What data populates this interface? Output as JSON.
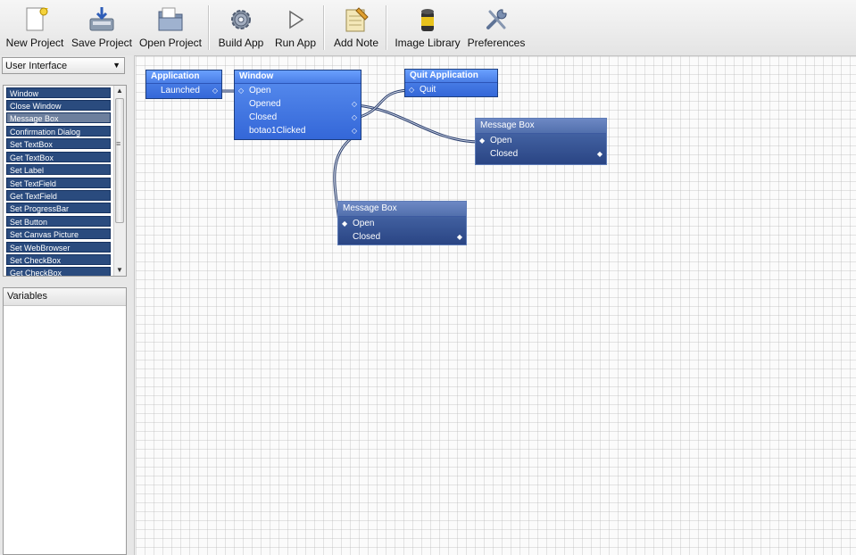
{
  "toolbar": {
    "items": [
      {
        "label": "New Project",
        "icon": "new-project-icon"
      },
      {
        "label": "Save Project",
        "icon": "save-project-icon"
      },
      {
        "label": "Open Project",
        "icon": "open-project-icon"
      },
      {
        "label": "Build App",
        "icon": "gear-icon"
      },
      {
        "label": "Run App",
        "icon": "play-icon"
      },
      {
        "label": "Add Note",
        "icon": "notepad-icon"
      },
      {
        "label": "Image Library",
        "icon": "image-library-icon"
      },
      {
        "label": "Preferences",
        "icon": "tools-icon"
      }
    ]
  },
  "sidebar": {
    "category": "User Interface",
    "blocks": [
      "Window",
      "Close Window",
      "Message Box",
      "Confirmation Dialog",
      "Set TextBox",
      "Get TextBox",
      "Set Label",
      "Set TextField",
      "Get TextField",
      "Set ProgressBar",
      "Set Button",
      "Set Canvas Picture",
      "Set WebBrowser",
      "Set CheckBox",
      "Get CheckBox"
    ],
    "selected_block": "Message Box",
    "variables_header": "Variables"
  },
  "canvas": {
    "nodes": {
      "application": {
        "title": "Application",
        "ports": [
          "Launched"
        ]
      },
      "window": {
        "title": "Window",
        "ports": [
          "Open",
          "Opened",
          "Closed",
          "botao1Clicked"
        ]
      },
      "quit": {
        "title": "Quit Application",
        "ports": [
          "Quit"
        ]
      },
      "msgbox1": {
        "title": "Message Box",
        "ports": [
          "Open",
          "Closed"
        ]
      },
      "msgbox2": {
        "title": "Message Box",
        "ports": [
          "Open",
          "Closed"
        ]
      }
    }
  },
  "colors": {
    "node_bright": "#3f74e0",
    "node_dark": "#2e4a8a",
    "block_item": "#2a4b7e",
    "wire": "#2b3f6e"
  }
}
